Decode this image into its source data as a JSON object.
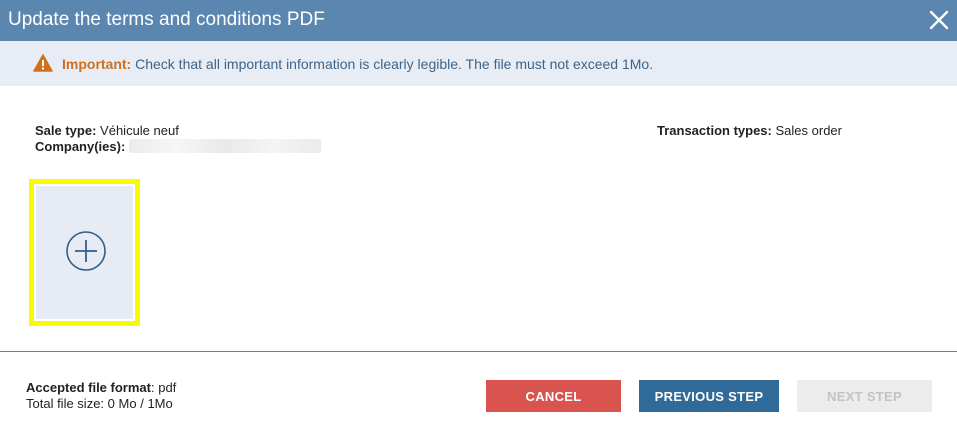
{
  "dialog": {
    "title": "Update the terms and conditions PDF",
    "close_icon": "close-icon"
  },
  "alert": {
    "icon": "warning-icon",
    "strong": "Important:",
    "message": "Check that all important information is clearly legible. The file must not exceed 1Mo."
  },
  "info": {
    "sale_type_label": "Sale type:",
    "sale_type_value": "Véhicule neuf",
    "company_label": "Company(ies):",
    "transaction_types_label": "Transaction types:",
    "transaction_types_value": "Sales order"
  },
  "upload": {
    "icon": "plus-circle-icon"
  },
  "footer": {
    "format_label": "Accepted file format",
    "format_value": ": pdf",
    "size_label": "Total file size:",
    "size_value": "0 Mo",
    "size_sep": "/",
    "size_max": "1Mo"
  },
  "buttons": {
    "cancel": "CANCEL",
    "previous": "PREVIOUS STEP",
    "next": "NEXT STEP"
  },
  "colors": {
    "header": "#5b86b0",
    "alert_bg": "#e8edf5",
    "alert_strong": "#d0701f",
    "cancel": "#d9534f",
    "previous": "#2f6a99",
    "next_disabled": "#ececec",
    "highlight": "#f7fa00"
  }
}
